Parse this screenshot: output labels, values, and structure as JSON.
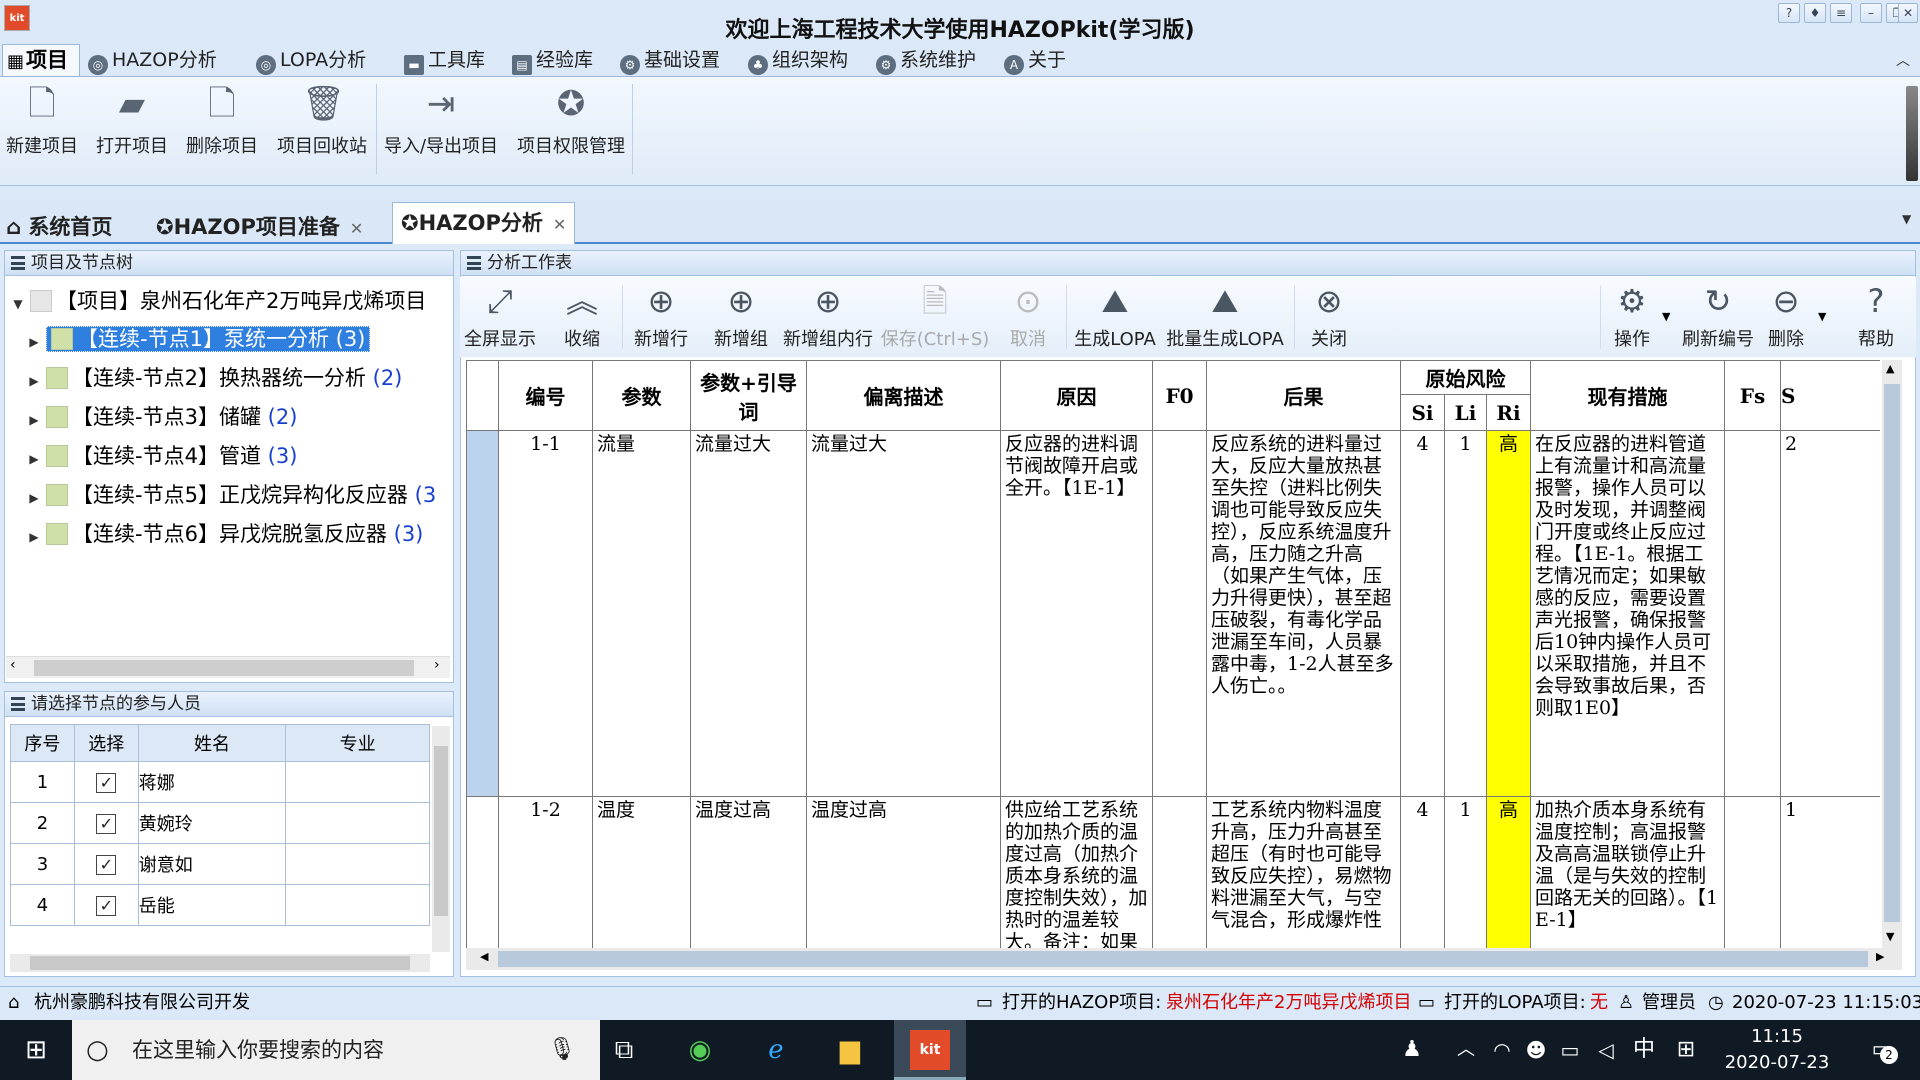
{
  "window": {
    "logo_text": "kit",
    "title": "欢迎上海工程技术大学使用HAZOPkit(学习版)"
  },
  "menu": {
    "items": [
      "项目",
      "HAZOP分析",
      "LOPA分析",
      "工具库",
      "经验库",
      "基础设置",
      "组织架构",
      "系统维护",
      "关于"
    ]
  },
  "ribbon": {
    "buttons": [
      "新建项目",
      "打开项目",
      "删除项目",
      "项目回收站",
      "导入/导出项目",
      "项目权限管理"
    ]
  },
  "tabs": {
    "home": "系统首页",
    "prep": "HAZOP项目准备",
    "analysis": "HAZOP分析"
  },
  "tree": {
    "header": "项目及节点树",
    "root": "【项目】泉州石化年产2万吨异戊烯项目",
    "nodes": [
      {
        "label": "【连续-节点1】泵统一分析",
        "count": "(3)"
      },
      {
        "label": "【连续-节点2】换热器统一分析",
        "count": "(2)"
      },
      {
        "label": "【连续-节点3】储罐",
        "count": "(2)"
      },
      {
        "label": "【连续-节点4】管道",
        "count": "(3)"
      },
      {
        "label": "【连续-节点5】正戊烷异构化反应器",
        "count": "(3"
      },
      {
        "label": "【连续-节点6】异戊烷脱氢反应器",
        "count": "(3)"
      }
    ]
  },
  "people": {
    "header": "请选择节点的参与人员",
    "columns": [
      "序号",
      "选择",
      "姓名",
      "专业"
    ],
    "rows": [
      {
        "no": "1",
        "checked": "✓",
        "name": "蒋娜",
        "major": ""
      },
      {
        "no": "2",
        "checked": "✓",
        "name": "黄婉玲",
        "major": ""
      },
      {
        "no": "3",
        "checked": "✓",
        "name": "谢意如",
        "major": ""
      },
      {
        "no": "4",
        "checked": "✓",
        "name": "岳能",
        "major": ""
      }
    ]
  },
  "worksheet": {
    "header": "分析工作表",
    "toolbar": [
      "全屏显示",
      "收缩",
      "新增行",
      "新增组",
      "新增组内行",
      "保存(Ctrl+S)",
      "取消",
      "生成LOPA",
      "批量生成LOPA",
      "关闭",
      "操作",
      "刷新编号",
      "删除",
      "帮助"
    ],
    "columns": {
      "no": "编号",
      "param": "参数",
      "param_guide": "参数+引导词",
      "deviation": "偏离描述",
      "cause": "原因",
      "f0": "F0",
      "consequence": "后果",
      "orig_risk": "原始风险",
      "si": "Si",
      "li": "Li",
      "ri": "Ri",
      "measures": "现有措施",
      "fs": "Fs",
      "s": "S"
    },
    "rows": [
      {
        "no": "1-1",
        "param": "流量",
        "param_guide": "流量过大",
        "deviation": "流量过大",
        "cause": "反应器的进料调节阀故障开启或全开。【1E-1】",
        "f0": "",
        "consequence": "反应系统的进料量过大，反应大量放热甚至失控（进料比例失调也可能导致反应失控），反应系统温度升高，压力随之升高（如果产生气体，压力升得更快），甚至超压破裂，有毒化学品泄漏至车间，人员暴露中毒，1-2人甚至多人伤亡。。",
        "si": "4",
        "li": "1",
        "ri": "高",
        "measures": "在反应器的进料管道上有流量计和高流量报警，操作人员可以及时发现，并调整阀门开度或终止反应过程。【1E-1。根据工艺情况而定；如果敏感的反应，需要设置声光报警，确保报警后10钟内操作人员可以采取措施，并且不会导致事故后果，否则取1E0】",
        "fs": "",
        "s": "2"
      },
      {
        "no": "1-2",
        "param": "温度",
        "param_guide": "温度过高",
        "deviation": "温度过高",
        "cause": "供应给工艺系统的加热介质的温度过高（加热介质本身系统的温度控制失效），加热时的温差较大。备注：如果加热介质的温度",
        "f0": "",
        "consequence": "工艺系统内物料温度升高，压力升高甚至超压（有时也可能导致反应失控），易燃物料泄漏至大气，与空气混合，形成爆炸性",
        "si": "4",
        "li": "1",
        "ri": "高",
        "measures": "加热介质本身系统有温度控制；高温报警及高高温联锁停止升温（是与失效的控制回路无关的回路）。【1E-1】",
        "fs": "",
        "s": "1"
      }
    ]
  },
  "statusbar": {
    "developer": "杭州豪鹏科技有限公司开发",
    "hazop_label": "打开的HAZOP项目:",
    "hazop_value": "泉州石化年产2万吨异戊烯项目",
    "lopa_label": "打开的LOPA项目:",
    "lopa_value": "无",
    "user": "管理员",
    "datetime": "2020-07-23 11:15:03"
  },
  "taskbar": {
    "search_placeholder": "在这里输入你要搜索的内容",
    "time": "11:15",
    "date": "2020-07-23",
    "ime": "中",
    "notifications": "2"
  },
  "colors": {
    "selection": "#2f7fe0",
    "high_risk": "#ffff00",
    "status_red": "#d40000"
  }
}
